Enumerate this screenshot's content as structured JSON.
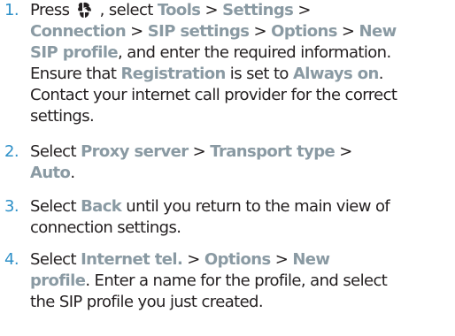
{
  "steps": [
    {
      "number": "1.",
      "lines": [
        [
          "Press ",
          "",
          " , select ",
          "Tools",
          " > ",
          "Settings",
          " >"
        ],
        [
          "Connection",
          " > ",
          "SIP settings",
          " > ",
          "Options",
          " > ",
          "New"
        ],
        [
          "SIP profile",
          ", and enter the required information."
        ],
        [
          "Ensure that ",
          "Registration",
          " is set to ",
          "Always on",
          "."
        ],
        [
          "Contact your internet call provider for the correct"
        ],
        [
          "settings."
        ]
      ],
      "menu_key_icon": "menu-key-icon"
    },
    {
      "number": "2.",
      "lines": [
        [
          "Select ",
          "Proxy server",
          " > ",
          "Transport type",
          " >"
        ],
        [
          "Auto",
          "."
        ]
      ]
    },
    {
      "number": "3.",
      "lines": [
        [
          "Select ",
          "Back",
          " until you return to the main view of"
        ],
        [
          "connection settings."
        ]
      ]
    },
    {
      "number": "4.",
      "lines": [
        [
          "Select ",
          "Internet tel.",
          " > ",
          "Options",
          " > ",
          "New"
        ],
        [
          "profile",
          ". Enter a name for the profile, and select"
        ],
        [
          "the SIP profile you just created."
        ]
      ]
    }
  ],
  "colors": {
    "number": "#2e90c8",
    "highlight": "#8a9aa3",
    "text": "#231f20"
  }
}
